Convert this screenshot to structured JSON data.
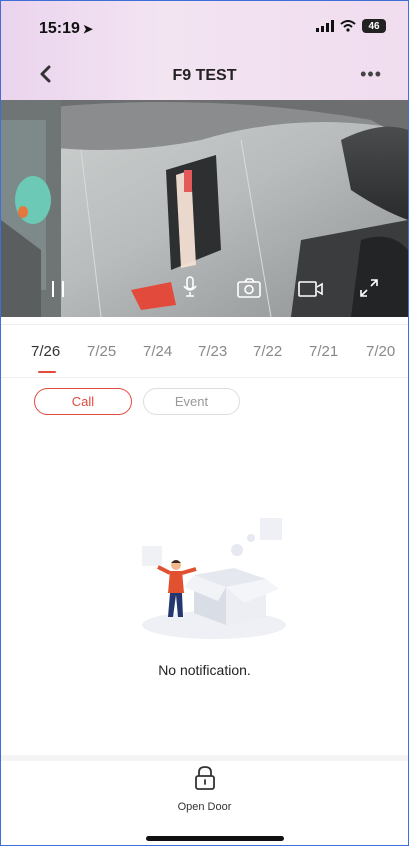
{
  "status_bar": {
    "time": "15:19",
    "battery": "46"
  },
  "header": {
    "title": "F9 TEST"
  },
  "tabs": [
    "7/26",
    "7/25",
    "7/24",
    "7/23",
    "7/22",
    "7/21",
    "7/20"
  ],
  "filters": {
    "call": "Call",
    "event": "Event"
  },
  "empty": {
    "message": "No notification."
  },
  "bottom": {
    "open_door": "Open Door"
  },
  "colors": {
    "accent": "#e24b3c",
    "header_bg": "#ead4ee"
  }
}
